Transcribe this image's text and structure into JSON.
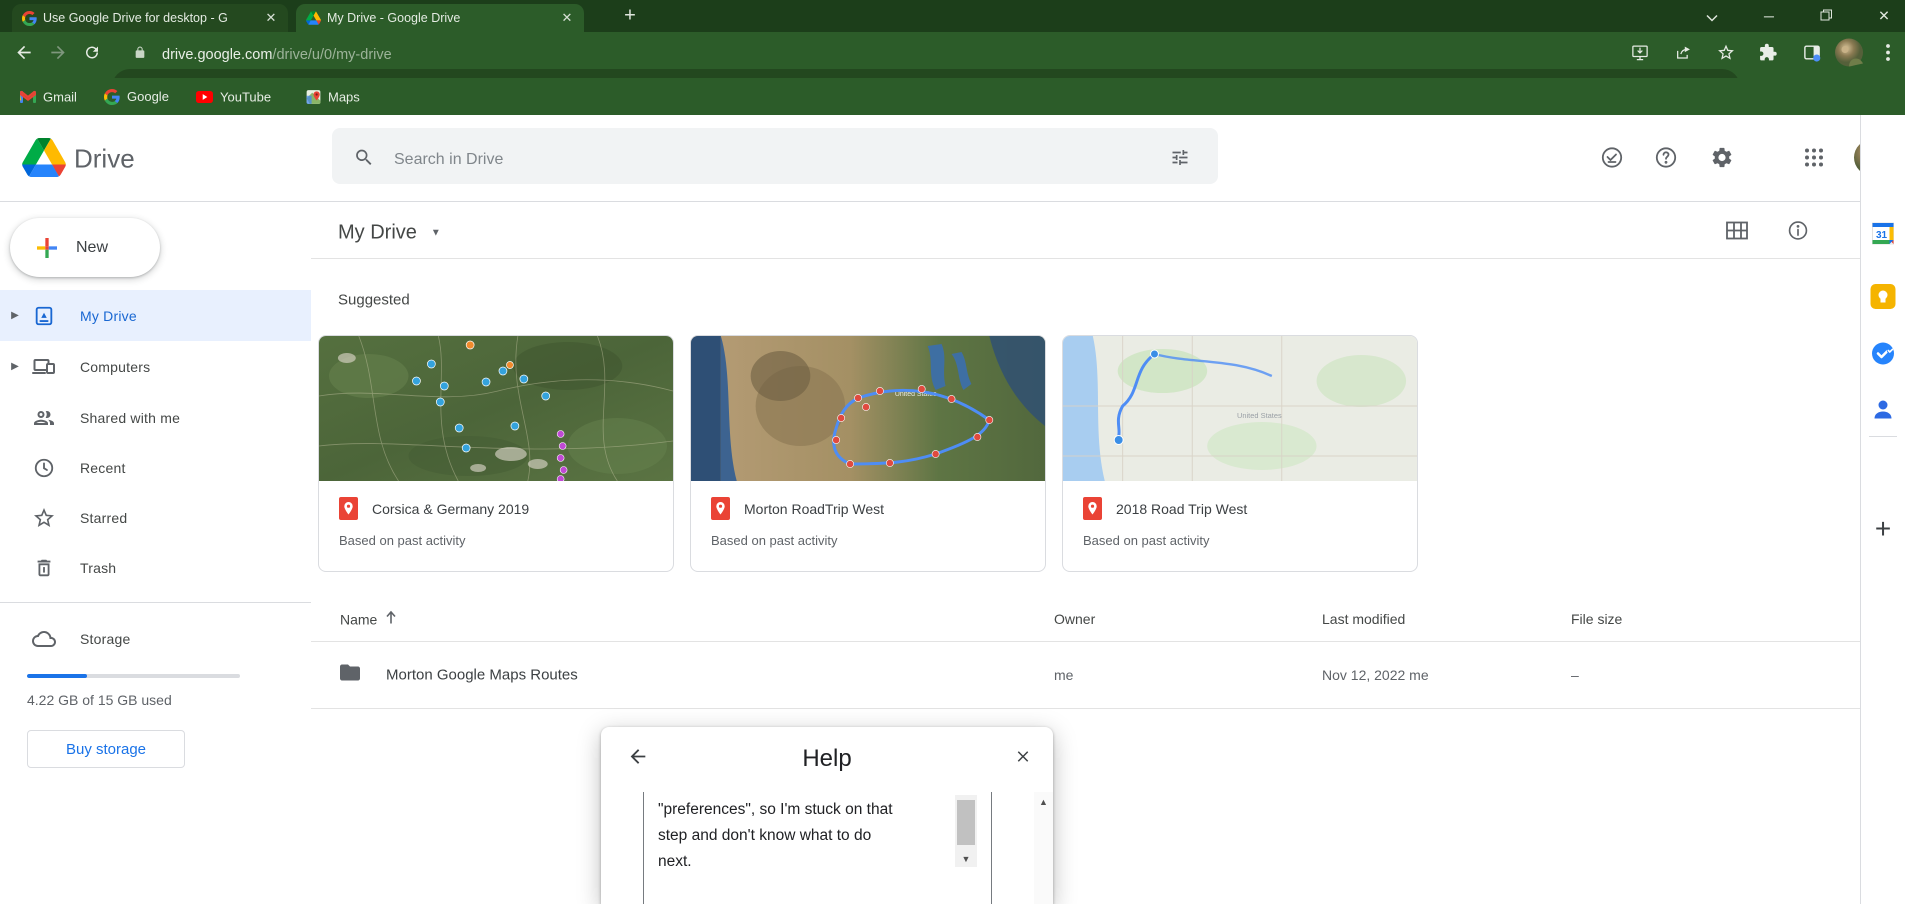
{
  "browser": {
    "tabs": [
      {
        "title": "Use Google Drive for desktop - G",
        "favicon": "google-logo",
        "active": false
      },
      {
        "title": "My Drive - Google Drive",
        "favicon": "drive-logo",
        "active": true
      }
    ],
    "url": {
      "host": "drive.google.com",
      "path": "/drive/u/0/my-drive"
    },
    "bookmarks": [
      {
        "label": "Gmail"
      },
      {
        "label": "Google"
      },
      {
        "label": "YouTube"
      },
      {
        "label": "Maps"
      }
    ]
  },
  "drive": {
    "app_name": "Drive",
    "search_placeholder": "Search in Drive",
    "sidebar": {
      "new_label": "New",
      "items": [
        {
          "label": "My Drive",
          "selected": true,
          "expandable": true
        },
        {
          "label": "Computers",
          "selected": false,
          "expandable": true
        },
        {
          "label": "Shared with me",
          "selected": false,
          "expandable": false
        },
        {
          "label": "Recent",
          "selected": false,
          "expandable": false
        },
        {
          "label": "Starred",
          "selected": false,
          "expandable": false
        },
        {
          "label": "Trash",
          "selected": false,
          "expandable": false
        }
      ],
      "storage": {
        "label": "Storage",
        "used_percent": 28,
        "usage_text": "4.22 GB of 15 GB used",
        "buy_label": "Buy storage"
      }
    },
    "content": {
      "title": "My Drive",
      "suggested_label": "Suggested",
      "cards": [
        {
          "title": "Corsica & Germany 2019",
          "subtitle": "Based on past activity",
          "thumb": "satellite-map-germany"
        },
        {
          "title": "Morton RoadTrip West",
          "subtitle": "Based on past activity",
          "thumb": "satellite-map-usa-route"
        },
        {
          "title": "2018 Road Trip West",
          "subtitle": "Based on past activity",
          "thumb": "road-map-west-route"
        }
      ],
      "table": {
        "columns": [
          "Name",
          "Owner",
          "Last modified",
          "File size"
        ],
        "rows": [
          {
            "name": "Morton Google Maps Routes",
            "owner": "me",
            "last_modified": "Nov 12, 2022 me",
            "file_size": "–",
            "icon": "folder"
          }
        ]
      }
    }
  },
  "help_dialog": {
    "title": "Help",
    "body_lines": [
      "\"preferences\", so I'm stuck on that",
      "step and don't know what to do",
      "next."
    ]
  },
  "colors": {
    "chrome_frame": "#1c3e1a",
    "chrome_toolbar": "#2c5c29",
    "chrome_urlbar": "#23481f",
    "accent_blue": "#1a73e8",
    "selected_item_bg": "#e8f0fe",
    "selected_item_text": "#1967d2",
    "search_bg": "#f1f3f4",
    "border_gray": "#dadce0",
    "text_gray": "#5f6368"
  }
}
